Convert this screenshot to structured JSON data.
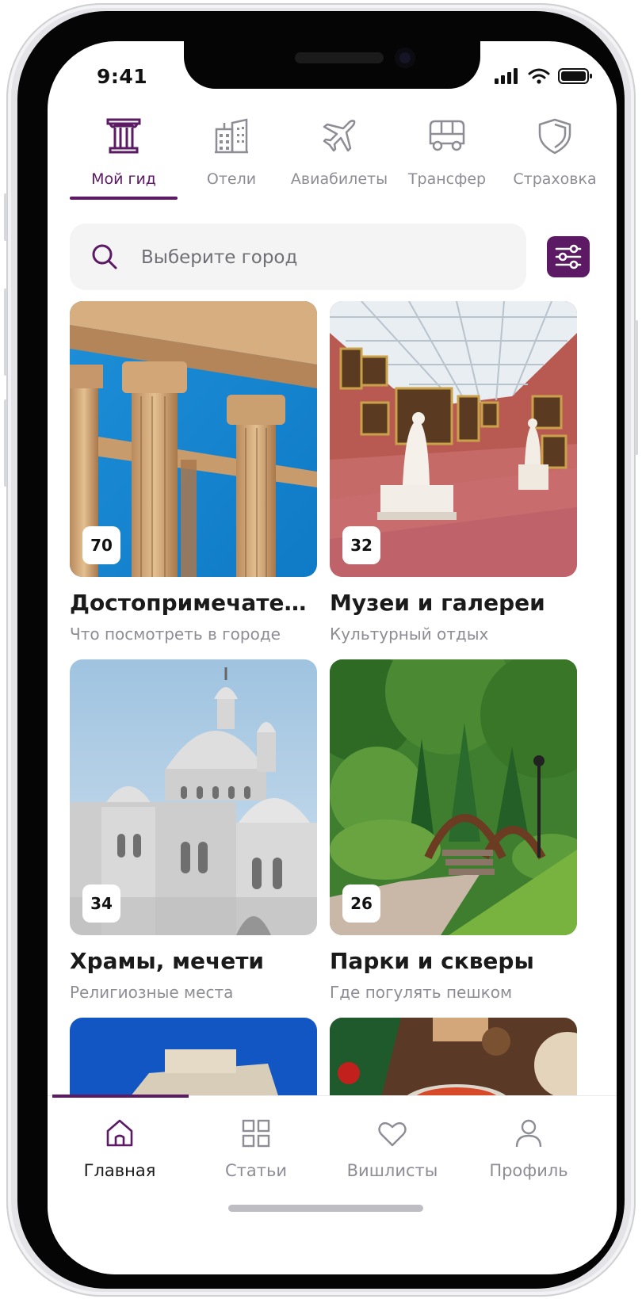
{
  "status_bar": {
    "time": "9:41"
  },
  "category_tabs": [
    {
      "label": "Мой гид",
      "icon": "column-icon",
      "active": true
    },
    {
      "label": "Отели",
      "icon": "buildings-icon",
      "active": false
    },
    {
      "label": "Авиабилеты",
      "icon": "airplane-icon",
      "active": false
    },
    {
      "label": "Трансфер",
      "icon": "bus-icon",
      "active": false
    },
    {
      "label": "Страховка",
      "icon": "shield-icon",
      "active": false
    }
  ],
  "search": {
    "placeholder": "Выберите город",
    "value": ""
  },
  "cards": [
    {
      "count": "70",
      "title": "Достопримечател...",
      "subtitle": "Что посмотреть в городе"
    },
    {
      "count": "32",
      "title": "Музеи и галереи",
      "subtitle": "Культурный отдых"
    },
    {
      "count": "34",
      "title": "Храмы, мечети",
      "subtitle": "Религиозные места"
    },
    {
      "count": "26",
      "title": "Парки и скверы",
      "subtitle": "Где погулять пешком"
    }
  ],
  "bottom_nav": [
    {
      "label": "Главная",
      "icon": "home-icon",
      "active": true
    },
    {
      "label": "Статьи",
      "icon": "grid-icon",
      "active": false
    },
    {
      "label": "Вишлисты",
      "icon": "heart-icon",
      "active": false
    },
    {
      "label": "Профиль",
      "icon": "user-icon",
      "active": false
    }
  ],
  "colors": {
    "accent": "#5b1a63",
    "muted_text": "#8d8d95",
    "search_bg": "#f4f4f5"
  }
}
